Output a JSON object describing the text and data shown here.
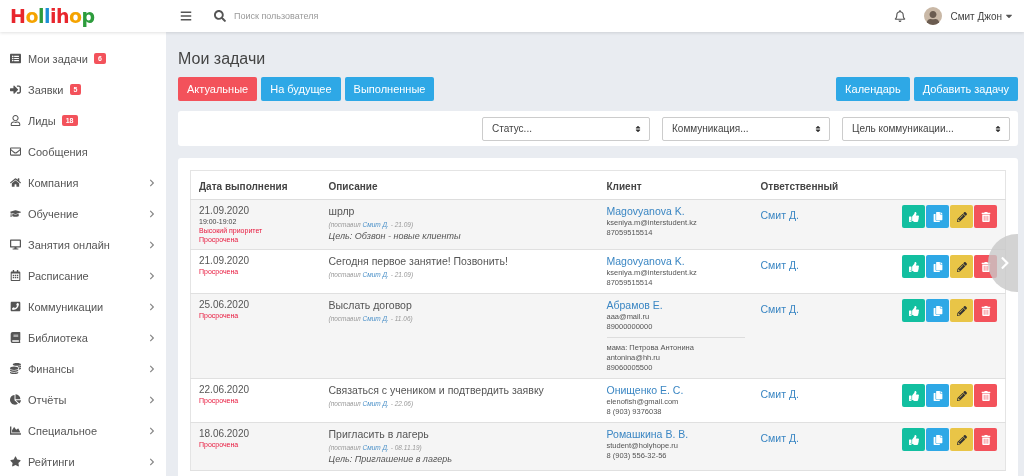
{
  "logo": "Hollihop",
  "header": {
    "search_placeholder": "Поиск пользователя",
    "user_name": "Смит Джон"
  },
  "sidebar": {
    "items": [
      {
        "label": "Мои задачи",
        "badge": "6",
        "expandable": false
      },
      {
        "label": "Заявки",
        "badge": "5",
        "expandable": false
      },
      {
        "label": "Лиды",
        "badge": "18",
        "expandable": false
      },
      {
        "label": "Сообщения",
        "expandable": false
      },
      {
        "label": "Компания",
        "expandable": true
      },
      {
        "label": "Обучение",
        "expandable": true
      },
      {
        "label": "Занятия онлайн",
        "expandable": true
      },
      {
        "label": "Расписание",
        "expandable": true
      },
      {
        "label": "Коммуникации",
        "expandable": true
      },
      {
        "label": "Библиотека",
        "expandable": true
      },
      {
        "label": "Финансы",
        "expandable": true
      },
      {
        "label": "Отчёты",
        "expandable": true
      },
      {
        "label": "Специальное",
        "expandable": true
      },
      {
        "label": "Рейтинги",
        "expandable": true
      }
    ]
  },
  "page_title": "Мои задачи",
  "tabs": [
    {
      "label": "Актуальные",
      "selected": true
    },
    {
      "label": "На будущее",
      "selected": false
    },
    {
      "label": "Выполненные",
      "selected": false
    }
  ],
  "actions": [
    "Календарь",
    "Добавить задачу"
  ],
  "filters": [
    "Статус...",
    "Коммуникация...",
    "Цель коммуникации..."
  ],
  "table": {
    "columns": [
      "Дата выполнения",
      "Описание",
      "Клиент",
      "Ответственный"
    ],
    "rows": [
      {
        "date": "21.09.2020",
        "time": "19:00-19:02",
        "priority": "Высокий приоритет",
        "status": "Просрочена",
        "title": "шрлр",
        "assigned": {
          "prefix": "(поставил",
          "author": "Смит Д.",
          "suffix": "- 21.09)"
        },
        "goal": "Цель: Обзвон - новые клиенты",
        "client": {
          "name": "Magovyanova K.",
          "email": "kseniya.m@interstudent.kz",
          "phone": "87059515514"
        },
        "responsible": "Смит Д."
      },
      {
        "date": "21.09.2020",
        "status": "Просрочена",
        "title": "Сегодня первое занятие! Позвонить!",
        "assigned": {
          "prefix": "(поставил",
          "author": "Смит Д.",
          "suffix": "- 21.09)"
        },
        "client": {
          "name": "Magovyanova K.",
          "email": "kseniya.m@interstudent.kz",
          "phone": "87059515514"
        },
        "responsible": "Смит Д."
      },
      {
        "date": "25.06.2020",
        "status": "Просрочена",
        "title": "Выслать договор",
        "assigned": {
          "prefix": "(поставил",
          "author": "Смит Д.",
          "suffix": "- 11.06)"
        },
        "client": {
          "name": "Абрамов Е.",
          "email": "aaa@mail.ru",
          "phone": "89000000000",
          "contact": {
            "name": "мама: Петрова Антонина",
            "email": "antonina@hh.ru",
            "phone": "89060005500"
          }
        },
        "responsible": "Смит Д."
      },
      {
        "date": "22.06.2020",
        "status": "Просрочена",
        "title": "Связаться с учеником и подтвердить заявку",
        "assigned": {
          "prefix": "(поставил",
          "author": "Смит Д.",
          "suffix": "- 22.06)"
        },
        "client": {
          "name": "Онищенко Е. С.",
          "email": "elenofish@gmail.com",
          "phone": "8 (903) 9376038"
        },
        "responsible": "Смит Д."
      },
      {
        "date": "18.06.2020",
        "status": "Просрочена",
        "title": "Пригласить в лагерь",
        "assigned": {
          "prefix": "(поставил",
          "author": "Смит Д.",
          "suffix": "- 08.11.19)"
        },
        "goal": "Цель: Приглашение в лагерь",
        "client": {
          "name": "Ромашкина В. В.",
          "email": "student@holyhope.ru",
          "phone": "8 (903) 556-32-56"
        },
        "responsible": "Смит Д."
      }
    ]
  }
}
